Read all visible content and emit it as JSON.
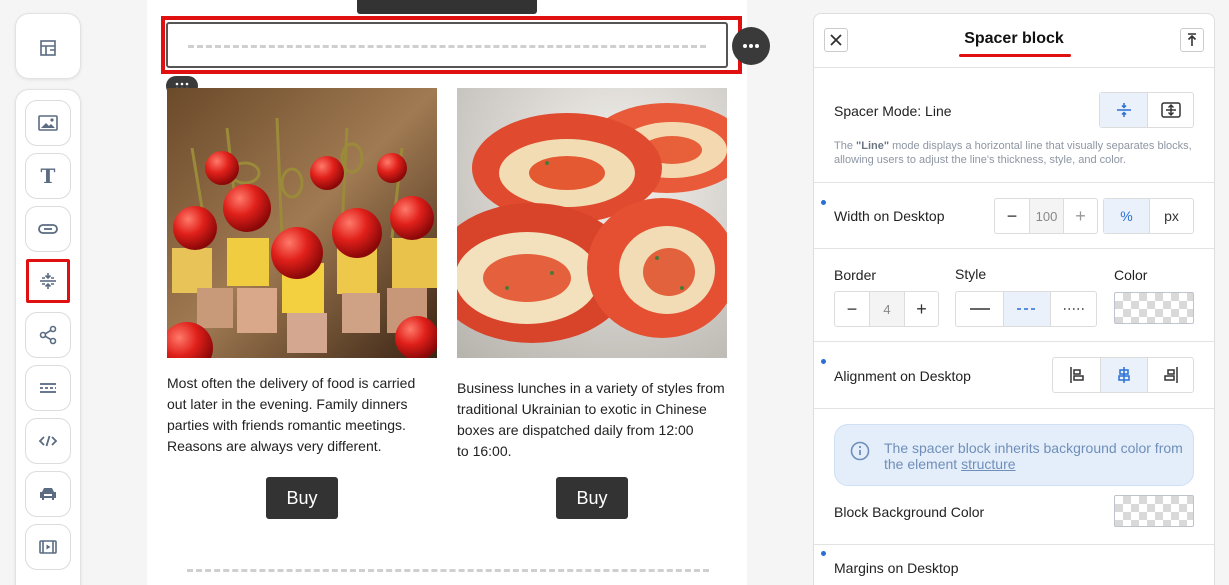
{
  "toolbar": {
    "structure_icon": "structure-icon",
    "tools": [
      {
        "name": "image-icon"
      },
      {
        "name": "text-icon",
        "glyph": "T"
      },
      {
        "name": "button-icon"
      },
      {
        "name": "spacer-icon",
        "active": true
      },
      {
        "name": "share-icon"
      },
      {
        "name": "menu-icon"
      },
      {
        "name": "code-icon"
      },
      {
        "name": "banner-icon"
      },
      {
        "name": "video-icon"
      }
    ],
    "active_color": "#e01010"
  },
  "canvas": {
    "columns": [
      {
        "image": "canapes-photo",
        "text": "Most often the delivery of food is carried\nout later in the evening. Family dinners\nparties with friends romantic meetings.\nReasons are always very different.",
        "button": "Buy"
      },
      {
        "image": "salmon-rolls-photo",
        "text": "Business lunches in a variety of styles from\ntraditional Ukrainian to exotic in Chinese\nboxes are dispatched daily from 12:00\nto 16:00.",
        "button": "Buy"
      }
    ]
  },
  "panel": {
    "title": "Spacer block",
    "close_icon": "close-icon",
    "collapse_icon": "collapse-icon",
    "spacer_mode": {
      "label": "Spacer Mode: Line",
      "help_bold": "\"Line\"",
      "help_pre": "The ",
      "help_post": " mode displays a horizontal line that visually separates blocks, allowing users to adjust the line's thickness, style, and color."
    },
    "width": {
      "label": "Width on Desktop",
      "minus": "−",
      "value": "100",
      "plus": "+",
      "unit_pct": "%",
      "unit_px": "px",
      "selected_unit": "%"
    },
    "border": {
      "label": "Border",
      "minus": "−",
      "value": "4",
      "plus": "+"
    },
    "style": {
      "label": "Style",
      "options": [
        "solid",
        "dashed",
        "dotted"
      ],
      "selected": "dashed"
    },
    "color": {
      "label": "Color"
    },
    "alignment": {
      "label": "Alignment on Desktop",
      "selected": "center"
    },
    "info": {
      "text": "The spacer block inherits background color from the element ",
      "link": "structure"
    },
    "block_bg": {
      "label": "Block Background Color"
    },
    "margins": {
      "label": "Margins on Desktop"
    },
    "accent": "#2a6fd6"
  }
}
